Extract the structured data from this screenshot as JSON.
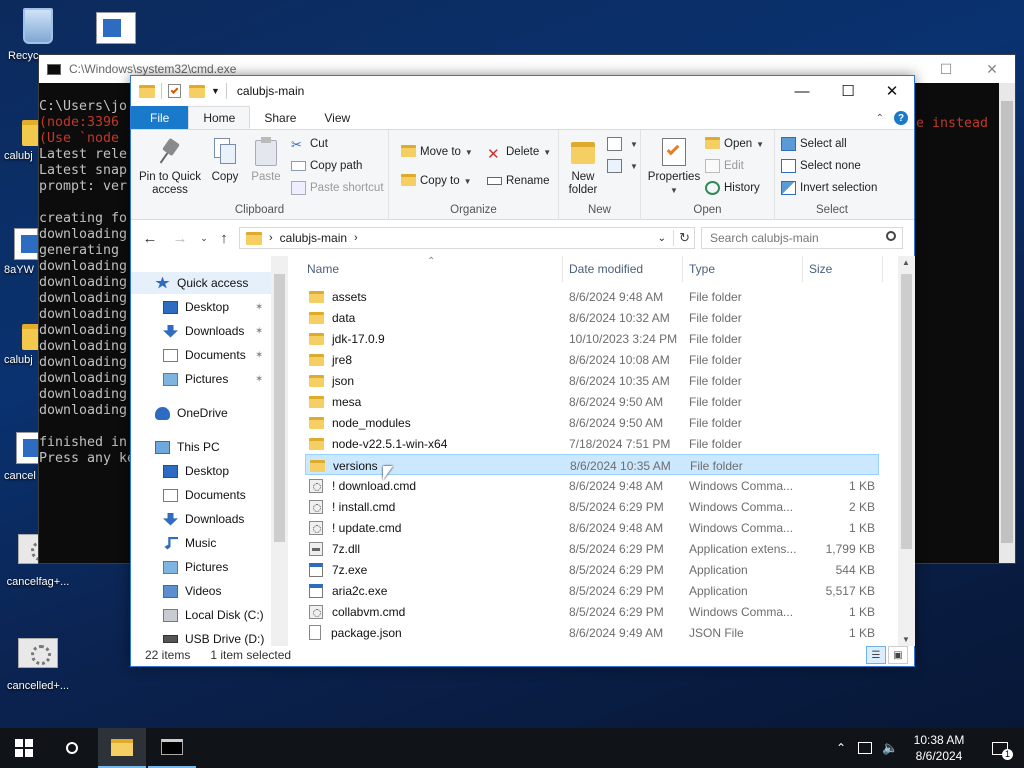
{
  "desktop": {
    "icons": [
      {
        "label": "Recyc"
      },
      {
        "label": ""
      },
      {
        "label": "calubj"
      },
      {
        "label": "8aYW"
      },
      {
        "label": "calubj"
      },
      {
        "label": "cancel"
      },
      {
        "label": "cancelfag+..."
      },
      {
        "label": "cancelled+..."
      }
    ]
  },
  "cmd": {
    "title": "C:\\Windows\\system32\\cmd.exe",
    "lines": [
      {
        "text": "C:\\Users\\jo",
        "color": "#c0c0c0"
      },
      {
        "text": "(node:3396",
        "color": "#c0392b"
      },
      {
        "text": "(Use `node",
        "color": "#c0392b"
      },
      {
        "text": "Latest rele",
        "color": "#c0c0c0"
      },
      {
        "text": "Latest snap",
        "color": "#c0c0c0"
      },
      {
        "text": "prompt: ver",
        "color": "#c0c0c0"
      },
      {
        "text": "",
        "color": "#c0c0c0"
      },
      {
        "text": "creating fo",
        "color": "#c0c0c0"
      },
      {
        "text": "downloading",
        "color": "#c0c0c0"
      },
      {
        "text": "generating",
        "color": "#c0c0c0"
      },
      {
        "text": "downloading",
        "color": "#c0c0c0"
      },
      {
        "text": "downloading",
        "color": "#c0c0c0"
      },
      {
        "text": "downloading",
        "color": "#c0c0c0"
      },
      {
        "text": "downloading",
        "color": "#c0c0c0"
      },
      {
        "text": "downloading",
        "color": "#c0c0c0"
      },
      {
        "text": "downloading",
        "color": "#c0c0c0"
      },
      {
        "text": "downloading",
        "color": "#c0c0c0"
      },
      {
        "text": "downloading",
        "color": "#c0c0c0"
      },
      {
        "text": "downloading",
        "color": "#c0c0c0"
      },
      {
        "text": "downloading",
        "color": "#c0c0c0"
      },
      {
        "text": "",
        "color": "#c0c0c0"
      },
      {
        "text": "finished in",
        "color": "#c0c0c0"
      },
      {
        "text": "Press any ke",
        "color": "#c0c0c0"
      }
    ],
    "right_text": "e instead"
  },
  "explorer": {
    "title": "calubjs-main",
    "tabs": {
      "file": "File",
      "home": "Home",
      "share": "Share",
      "view": "View"
    },
    "ribbon": {
      "clipboard": {
        "label": "Clipboard",
        "pin": "Pin to Quick access",
        "copy": "Copy",
        "paste": "Paste",
        "cut": "Cut",
        "copy_path": "Copy path",
        "paste_shortcut": "Paste shortcut"
      },
      "organize": {
        "label": "Organize",
        "move_to": "Move to",
        "copy_to": "Copy to",
        "delete": "Delete",
        "rename": "Rename"
      },
      "new": {
        "label": "New",
        "new_folder": "New folder"
      },
      "open": {
        "label": "Open",
        "properties": "Properties",
        "open": "Open",
        "edit": "Edit",
        "history": "History"
      },
      "select": {
        "label": "Select",
        "select_all": "Select all",
        "select_none": "Select none",
        "invert": "Invert selection"
      }
    },
    "address": {
      "path": "calubjs-main",
      "search_placeholder": "Search calubjs-main"
    },
    "nav": [
      {
        "label": "Quick access",
        "indent": 0,
        "icon": "star",
        "pin": false,
        "selected": true
      },
      {
        "label": "Desktop",
        "indent": 1,
        "icon": "desktop",
        "pin": true
      },
      {
        "label": "Downloads",
        "indent": 1,
        "icon": "download",
        "pin": true
      },
      {
        "label": "Documents",
        "indent": 1,
        "icon": "document",
        "pin": true
      },
      {
        "label": "Pictures",
        "indent": 1,
        "icon": "picture",
        "pin": true
      },
      {
        "label": "",
        "indent": 0,
        "icon": "",
        "pin": false,
        "spacer": true
      },
      {
        "label": "OneDrive",
        "indent": 0,
        "icon": "cloud",
        "pin": false
      },
      {
        "label": "",
        "indent": 0,
        "icon": "",
        "pin": false,
        "spacer": true
      },
      {
        "label": "This PC",
        "indent": 0,
        "icon": "pc",
        "pin": false
      },
      {
        "label": "Desktop",
        "indent": 1,
        "icon": "desktop",
        "pin": false
      },
      {
        "label": "Documents",
        "indent": 1,
        "icon": "document",
        "pin": false
      },
      {
        "label": "Downloads",
        "indent": 1,
        "icon": "download",
        "pin": false
      },
      {
        "label": "Music",
        "indent": 1,
        "icon": "music",
        "pin": false
      },
      {
        "label": "Pictures",
        "indent": 1,
        "icon": "picture",
        "pin": false
      },
      {
        "label": "Videos",
        "indent": 1,
        "icon": "video",
        "pin": false
      },
      {
        "label": "Local Disk (C:)",
        "indent": 1,
        "icon": "disk",
        "pin": false
      },
      {
        "label": "USB Drive (D:)",
        "indent": 1,
        "icon": "usb",
        "pin": false
      }
    ],
    "columns": {
      "name": "Name",
      "date": "Date modified",
      "type": "Type",
      "size": "Size"
    },
    "files": [
      {
        "name": "assets",
        "date": "8/6/2024 9:48 AM",
        "type": "File folder",
        "size": "",
        "kind": "folder"
      },
      {
        "name": "data",
        "date": "8/6/2024 10:32 AM",
        "type": "File folder",
        "size": "",
        "kind": "folder"
      },
      {
        "name": "jdk-17.0.9",
        "date": "10/10/2023 3:24 PM",
        "type": "File folder",
        "size": "",
        "kind": "folder"
      },
      {
        "name": "jre8",
        "date": "8/6/2024 10:08 AM",
        "type": "File folder",
        "size": "",
        "kind": "folder"
      },
      {
        "name": "json",
        "date": "8/6/2024 10:35 AM",
        "type": "File folder",
        "size": "",
        "kind": "folder"
      },
      {
        "name": "mesa",
        "date": "8/6/2024 9:50 AM",
        "type": "File folder",
        "size": "",
        "kind": "folder"
      },
      {
        "name": "node_modules",
        "date": "8/6/2024 9:50 AM",
        "type": "File folder",
        "size": "",
        "kind": "folder"
      },
      {
        "name": "node-v22.5.1-win-x64",
        "date": "7/18/2024 7:51 PM",
        "type": "File folder",
        "size": "",
        "kind": "folder"
      },
      {
        "name": "versions",
        "date": "8/6/2024 10:35 AM",
        "type": "File folder",
        "size": "",
        "kind": "folder",
        "selected": true
      },
      {
        "name": "! download.cmd",
        "date": "8/6/2024 9:48 AM",
        "type": "Windows Comma...",
        "size": "1 KB",
        "kind": "cmd"
      },
      {
        "name": "! install.cmd",
        "date": "8/5/2024 6:29 PM",
        "type": "Windows Comma...",
        "size": "2 KB",
        "kind": "cmd"
      },
      {
        "name": "! update.cmd",
        "date": "8/6/2024 9:48 AM",
        "type": "Windows Comma...",
        "size": "1 KB",
        "kind": "cmd"
      },
      {
        "name": "7z.dll",
        "date": "8/5/2024 6:29 PM",
        "type": "Application extens...",
        "size": "1,799 KB",
        "kind": "dll"
      },
      {
        "name": "7z.exe",
        "date": "8/5/2024 6:29 PM",
        "type": "Application",
        "size": "544 KB",
        "kind": "exe"
      },
      {
        "name": "aria2c.exe",
        "date": "8/5/2024 6:29 PM",
        "type": "Application",
        "size": "5,517 KB",
        "kind": "exe"
      },
      {
        "name": "collabvm.cmd",
        "date": "8/5/2024 6:29 PM",
        "type": "Windows Comma...",
        "size": "1 KB",
        "kind": "cmd"
      },
      {
        "name": "package.json",
        "date": "8/6/2024 9:49 AM",
        "type": "JSON File",
        "size": "1 KB",
        "kind": "json"
      }
    ],
    "status": {
      "count": "22 items",
      "selected": "1 item selected"
    }
  },
  "taskbar": {
    "time": "10:38 AM",
    "date": "8/6/2024"
  },
  "colors": {
    "accent": "#1979ca",
    "selection": "#cce8ff",
    "folder": "#f5cf63"
  }
}
